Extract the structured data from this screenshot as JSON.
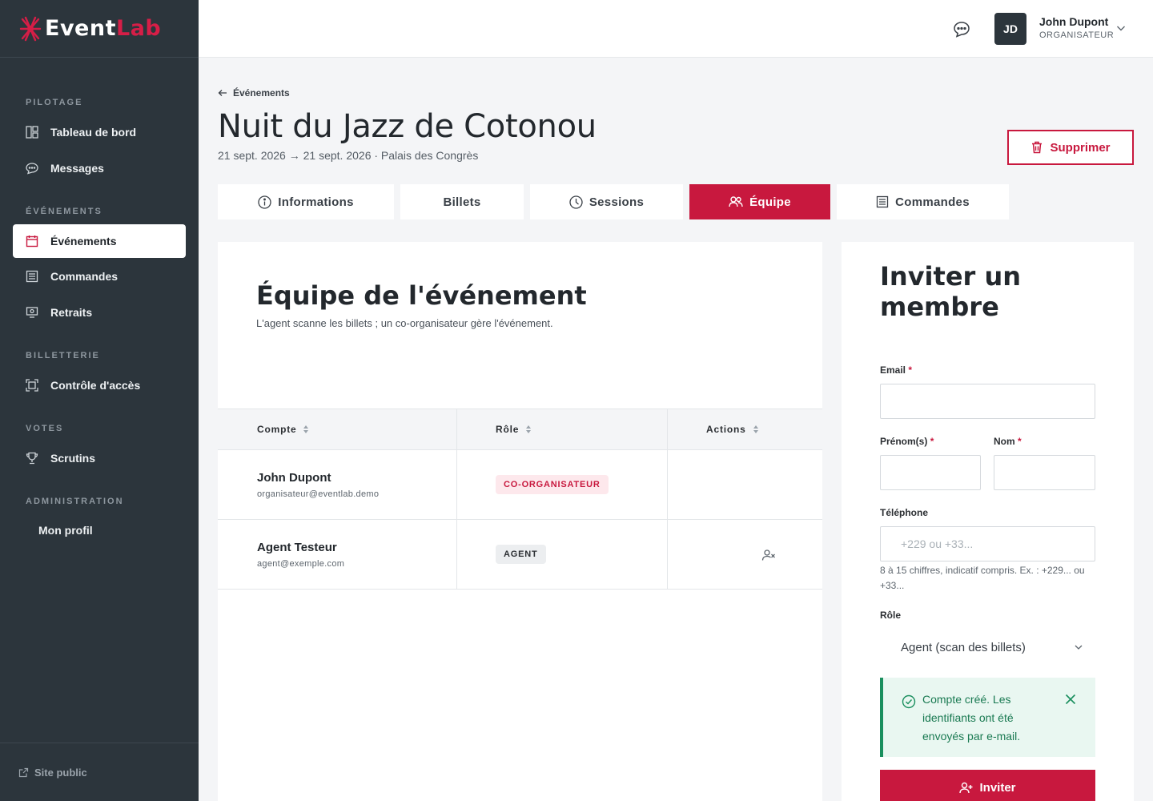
{
  "brand": {
    "name_part1": "Event",
    "name_part2": "Lab"
  },
  "sidebar": {
    "sections": [
      "PILOTAGE",
      "ÉVÉNEMENTS",
      "BILLETTERIE",
      "VOTES",
      "ADMINISTRATION"
    ],
    "items": [
      {
        "label": "Tableau de bord",
        "icon": "dashboard-icon"
      },
      {
        "label": "Messages",
        "icon": "chat-icon"
      },
      {
        "label": "Événements",
        "icon": "calendar-icon",
        "active": true
      },
      {
        "label": "Commandes",
        "icon": "list-icon"
      },
      {
        "label": "Retraits",
        "icon": "withdraw-icon"
      },
      {
        "label": "Contrôle d'accès",
        "icon": "scan-icon"
      },
      {
        "label": "Scrutins",
        "icon": "trophy-icon"
      },
      {
        "label": "Mon profil",
        "icon": ""
      }
    ],
    "footer_link": "Site public"
  },
  "topbar": {
    "avatar_initials": "JD",
    "user_name": "John Dupont",
    "user_role": "ORGANISATEUR"
  },
  "header": {
    "back_label": "Événements",
    "title": "Nuit du Jazz de Cotonou",
    "subtitle": "21 sept. 2026 → 21 sept. 2026 · Palais des Congrès",
    "delete_label": "Supprimer"
  },
  "tabs": [
    {
      "label": "Informations",
      "icon": "info-icon"
    },
    {
      "label": "Billets",
      "icon": ""
    },
    {
      "label": "Sessions",
      "icon": "clock-icon"
    },
    {
      "label": "Équipe",
      "icon": "team-icon",
      "active": true
    },
    {
      "label": "Commandes",
      "icon": "list-icon"
    }
  ],
  "team": {
    "title": "Équipe de l'événement",
    "subtitle": "L'agent scanne les billets ; un co-organisateur gère l'événement.",
    "columns": [
      "Compte",
      "Rôle",
      "Actions"
    ],
    "rows": [
      {
        "name": "John Dupont",
        "email": "organisateur@eventlab.demo",
        "role": "CO-ORGANISATEUR"
      },
      {
        "name": "Agent Testeur",
        "email": "agent@exemple.com",
        "role": "AGENT"
      }
    ]
  },
  "invite": {
    "title": "Inviter un membre",
    "email_label": "Email",
    "firstname_label": "Prénom(s)",
    "lastname_label": "Nom",
    "required_mark": "*",
    "phone_label": "Téléphone",
    "phone_placeholder": "+229 ou +33...",
    "phone_help": "8 à 15 chiffres, indicatif compris. Ex. : +229... ou +33...",
    "role_label": "Rôle",
    "role_value": "Agent (scan des billets)",
    "alert_text": "Compte créé. Les identifiants ont été envoyés par e-mail.",
    "submit_label": "Inviter"
  },
  "colors": {
    "accent": "#c8183e",
    "sidebar": "#2c353c",
    "success": "#1a8f5e"
  }
}
